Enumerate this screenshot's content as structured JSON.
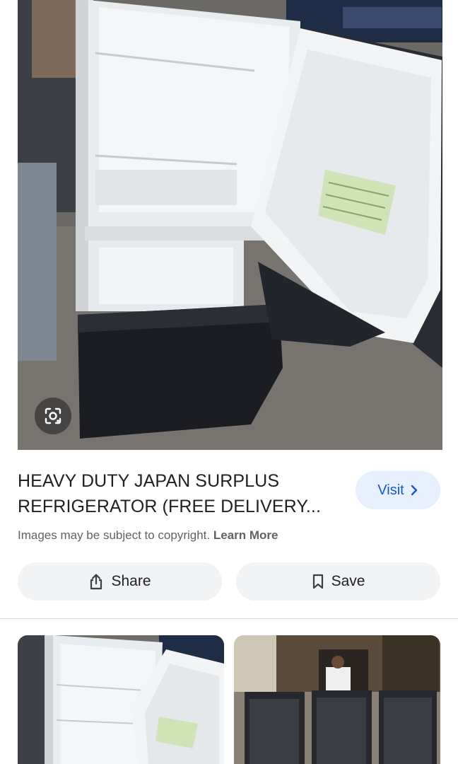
{
  "result": {
    "title": "HEAVY DUTY JAPAN SURPLUS REFRIGERATOR (FREE DELIVERY...",
    "visit_label": "Visit",
    "copyright_text": "Images may be subject to copyright.",
    "learn_more": "Learn More"
  },
  "actions": {
    "share_label": "Share",
    "save_label": "Save"
  },
  "icons": [
    "lens-icon",
    "chevron-right-icon",
    "share-icon",
    "bookmark-icon"
  ],
  "colors": {
    "visit_bg": "#e8f0fe",
    "visit_text": "#1a56c4",
    "button_bg": "#f1f3f4"
  }
}
